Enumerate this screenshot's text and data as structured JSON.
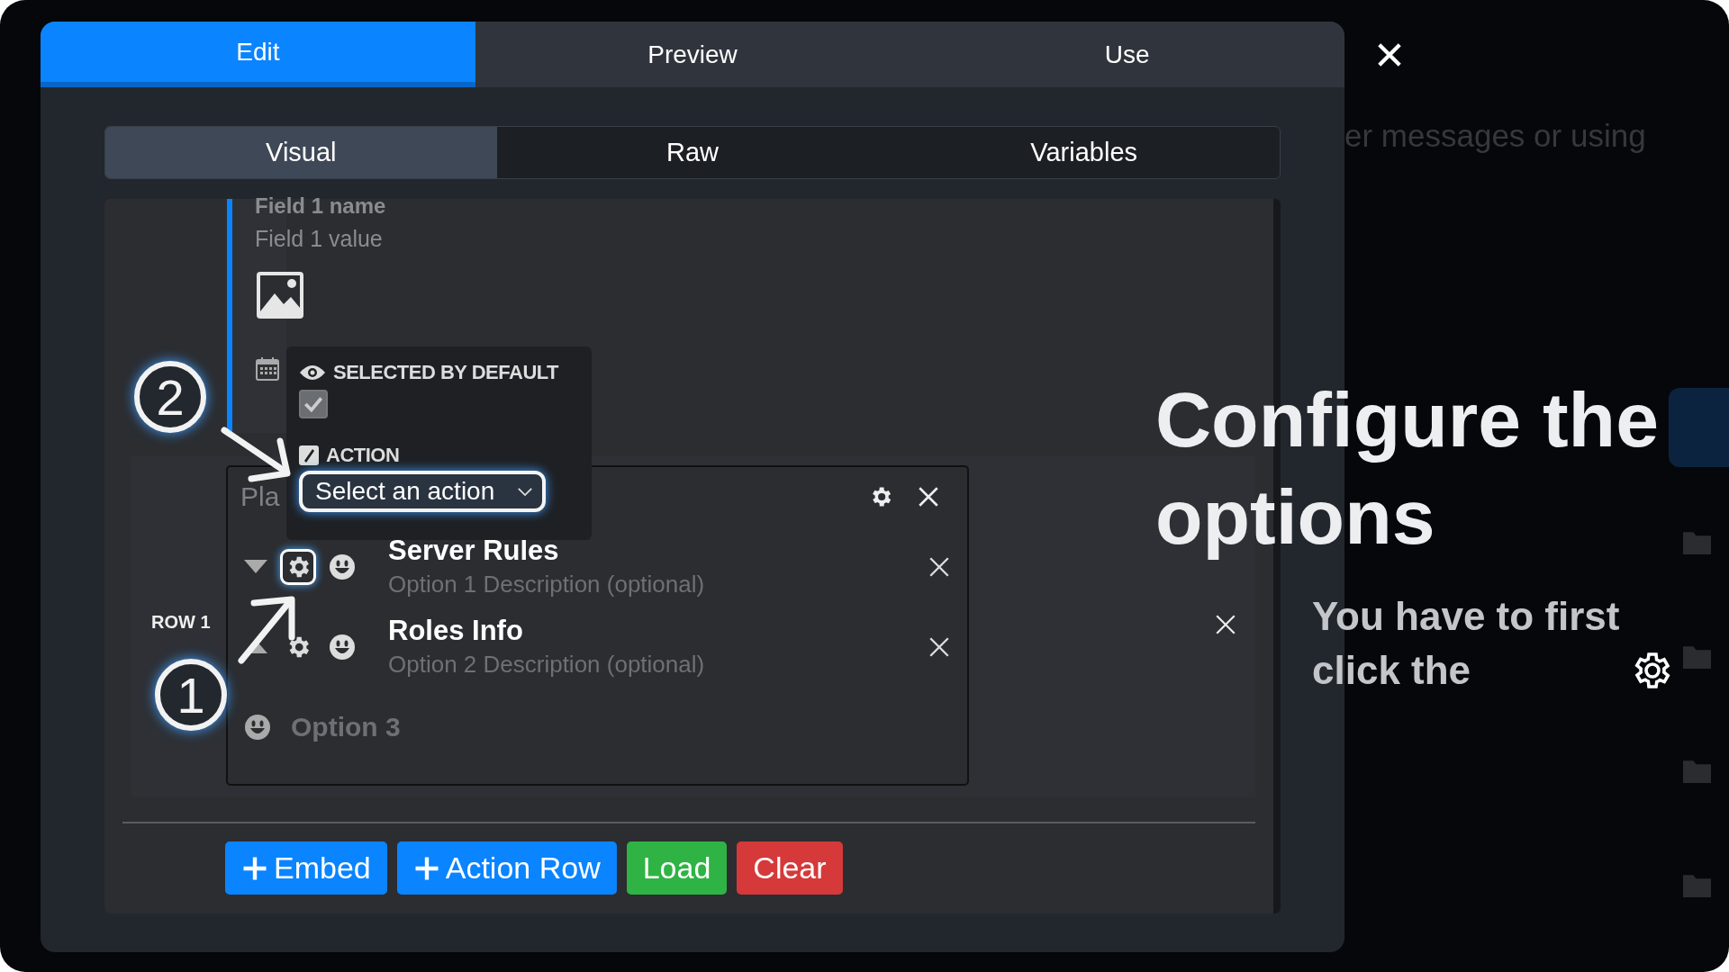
{
  "top_tabs": [
    {
      "label": "Edit",
      "selected": true
    },
    {
      "label": "Preview",
      "selected": false
    },
    {
      "label": "Use",
      "selected": false
    }
  ],
  "sub_tabs": [
    {
      "label": "Visual",
      "selected": true
    },
    {
      "label": "Raw",
      "selected": false
    },
    {
      "label": "Variables",
      "selected": false
    }
  ],
  "embed": {
    "field_name": "Field 1 name",
    "field_value": "Field 1 value"
  },
  "action_row": {
    "label": "ROW 1",
    "menu": {
      "placeholder": "Pla",
      "options": [
        {
          "label": "Server Rules",
          "description": "Option 1 Description (optional)",
          "arrow_up": false,
          "gear_highlighted": true,
          "kind": "option"
        },
        {
          "label": "Roles Info",
          "description": "Option 2 Description (optional)",
          "arrow_up": true,
          "gear_highlighted": false,
          "kind": "option"
        },
        {
          "label": "Option 3",
          "kind": "add"
        }
      ]
    }
  },
  "popup": {
    "default_label": "SELECTED BY DEFAULT",
    "checked": true,
    "action_label": "ACTION",
    "action_select": "Select an action"
  },
  "buttons": [
    {
      "label": "Embed",
      "plus": true,
      "kind": "primary"
    },
    {
      "label": "Action Row",
      "plus": true,
      "kind": "primary"
    },
    {
      "label": "Load",
      "plus": false,
      "kind": "success"
    },
    {
      "label": "Clear",
      "plus": false,
      "kind": "danger"
    }
  ],
  "background": {
    "snippet": "er messages or using"
  },
  "tutorial": {
    "headline": "Configure the options",
    "body": "You have to first click the",
    "steps": [
      "1",
      "2"
    ]
  }
}
